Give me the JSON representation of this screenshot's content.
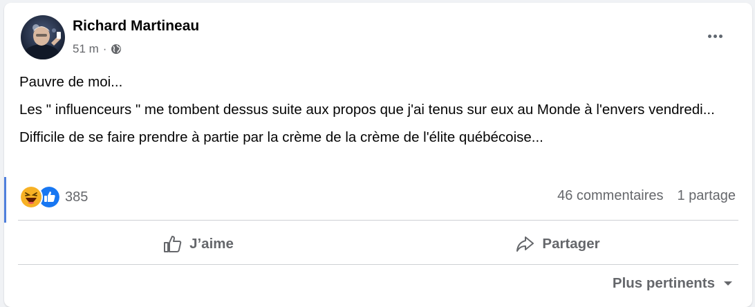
{
  "post": {
    "author": "Richard Martineau",
    "time": "51 m",
    "separator": "·",
    "privacy_icon": "globe-icon",
    "paragraphs": [
      "Pauvre de moi...",
      "Les \" influenceurs \" me tombent dessus suite aux propos que j'ai tenus sur eux au Monde à l'envers vendredi...",
      "Difficile de se faire prendre à partie par la crème de la crème de l'élite québécoise..."
    ]
  },
  "reactions": {
    "icons": [
      "laughing-emoji-icon",
      "like-icon"
    ],
    "count": "385"
  },
  "stats": {
    "comments": "46 commentaires",
    "shares": "1 partage"
  },
  "actions": {
    "like_label": "J’aime",
    "share_label": "Partager"
  },
  "comments_sort": {
    "label": "Plus pertinents"
  },
  "colors": {
    "brand_blue": "#1877f2",
    "secondary_text": "#65676b",
    "accent_bar": "#4f7fdc"
  }
}
